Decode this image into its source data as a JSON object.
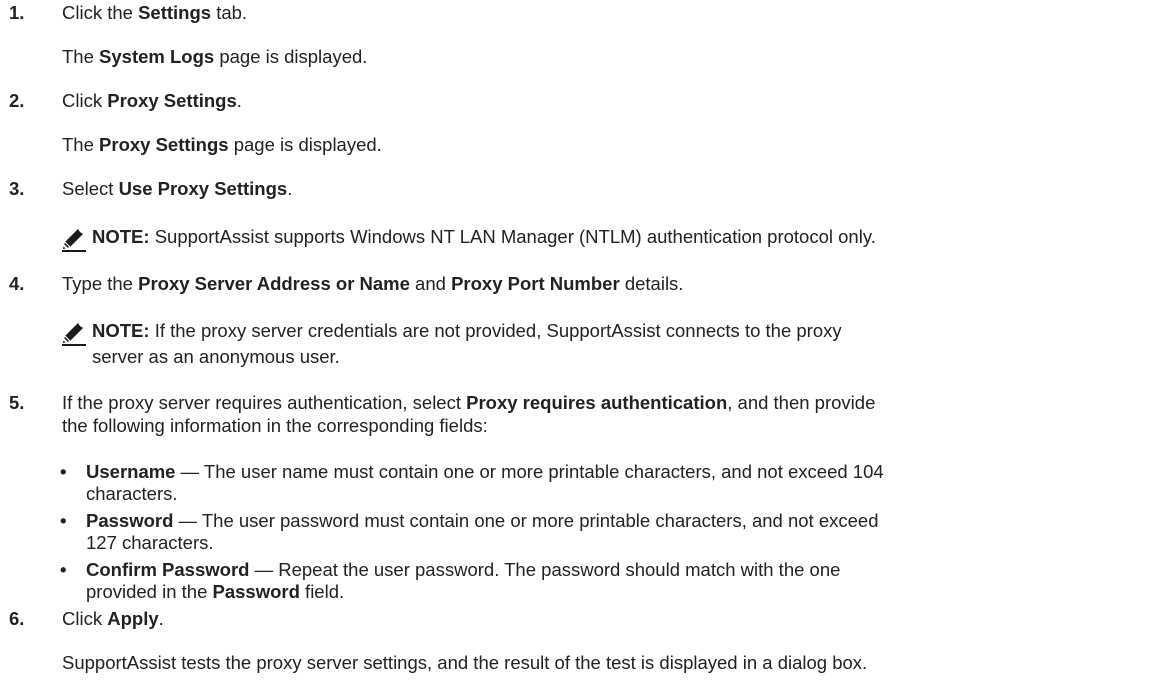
{
  "steps": [
    {
      "number": "1.",
      "pre": "Click the ",
      "bold": "Settings",
      "post": " tab.",
      "result_pre": "The ",
      "result_bold": "System Logs",
      "result_post": " page is displayed."
    },
    {
      "number": "2.",
      "pre": "Click ",
      "bold": "Proxy Settings",
      "post": ".",
      "result_pre": "The ",
      "result_bold": "Proxy Settings",
      "result_post": " page is displayed."
    },
    {
      "number": "3.",
      "pre": "Select ",
      "bold": "Use Proxy Settings",
      "post": ".",
      "note_label": "NOTE:",
      "note_text": " SupportAssist supports Windows NT LAN Manager (NTLM) authentication protocol only."
    },
    {
      "number": "4.",
      "pre": "Type the ",
      "bold": "Proxy Server Address or Name",
      "mid": " and ",
      "bold2": "Proxy Port Number",
      "post": " details.",
      "note_label": "NOTE:",
      "note_text_1": " If the proxy server credentials are not provided, SupportAssist connects to the proxy",
      "note_text_2": "server as an anonymous user."
    },
    {
      "number": "5.",
      "pre": "If the proxy server requires authentication, select ",
      "bold": "Proxy requires authentication",
      "post": ", and then provide",
      "line2": "the following information in the corresponding fields:",
      "bullets": [
        {
          "bold": "Username",
          "text_1": " — The user name must contain one or more printable characters, and not exceed 104",
          "text_2": "characters."
        },
        {
          "bold": "Password",
          "text_1": " — The user password must contain one or more printable characters, and not exceed",
          "text_2": "127 characters."
        },
        {
          "bold": "Confirm Password",
          "text_1": " — Repeat the user password. The password should match with the one",
          "text_2_pre": "provided in the ",
          "text_2_bold": "Password",
          "text_2_post": " field."
        }
      ]
    },
    {
      "number": "6.",
      "pre": "Click ",
      "bold": "Apply",
      "post": ".",
      "result": "SupportAssist tests the proxy server settings, and the result of the test is displayed in a dialog box."
    }
  ],
  "bullet_char": "•",
  "icon": "note-pencil-icon"
}
